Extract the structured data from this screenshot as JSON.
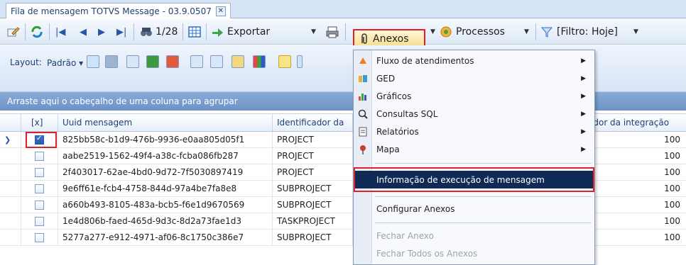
{
  "tab": {
    "title": "Fila de mensagem TOTVS Message - 03.9.0507",
    "close": "✕"
  },
  "toolbar": {
    "page_counter": "1/28",
    "export_label": "Exportar",
    "anexos_label": "Anexos",
    "processos_label": "Processos",
    "filter_label": "[Filtro: Hoje]"
  },
  "layout": {
    "label": "Layout:",
    "value": "Padrão ▾"
  },
  "group_area": {
    "text": "Arraste aqui o cabeçalho de uma coluna para agrupar"
  },
  "grid": {
    "columns": [
      "[x]",
      "Uuid mensagem",
      "Identificador da",
      "ador da integração"
    ],
    "rows": [
      {
        "checked": true,
        "uuid": "825bb58c-b1d9-476b-9936-e0aa805d05f1",
        "ident": "PROJECT",
        "value": "100"
      },
      {
        "checked": false,
        "uuid": "aabe2519-1562-49f4-a38c-fcba086fb287",
        "ident": "PROJECT",
        "value": "100"
      },
      {
        "checked": false,
        "uuid": "2f403017-62ae-4bd0-9d72-7f5030897419",
        "ident": "PROJECT",
        "value": "100"
      },
      {
        "checked": false,
        "uuid": "9e6ff61e-fcb4-4758-844d-97a4be7fa8e8",
        "ident": "SUBPROJECT",
        "value": "100"
      },
      {
        "checked": false,
        "uuid": "a660b493-8105-483a-bcb5-f6e1d9670569",
        "ident": "SUBPROJECT",
        "value": "100"
      },
      {
        "checked": false,
        "uuid": "1e4d806b-faed-465d-9d3c-8d2a73fae1d3",
        "ident": "TASKPROJECT",
        "value": "100"
      },
      {
        "checked": false,
        "uuid": "5277a277-e912-4971-af06-8c1750c386e7",
        "ident": "SUBPROJECT",
        "value": "100"
      }
    ]
  },
  "menu": {
    "items": [
      {
        "label": "Fluxo de atendimentos",
        "icon": "flow-icon",
        "submenu": true
      },
      {
        "label": "GED",
        "icon": "ged-icon",
        "submenu": true
      },
      {
        "label": "Gráficos",
        "icon": "chart-icon",
        "submenu": true
      },
      {
        "label": "Consultas SQL",
        "icon": "sql-query-icon",
        "submenu": true
      },
      {
        "label": "Relatórios",
        "icon": "report-icon",
        "submenu": true
      },
      {
        "label": "Mapa",
        "icon": "map-pin-icon",
        "submenu": true
      },
      {
        "label": "Informação de execução de mensagem",
        "icon": "",
        "submenu": false
      },
      {
        "label": "Configurar Anexos",
        "icon": "",
        "submenu": false
      },
      {
        "label": "Fechar Anexo",
        "icon": "",
        "submenu": false
      },
      {
        "label": "Fechar Todos os Anexos",
        "icon": "",
        "submenu": false
      }
    ]
  },
  "colors": {
    "accent_red": "#e0212b",
    "highlight_navy": "#0e2a55",
    "header_blue": "#6d92c6"
  }
}
